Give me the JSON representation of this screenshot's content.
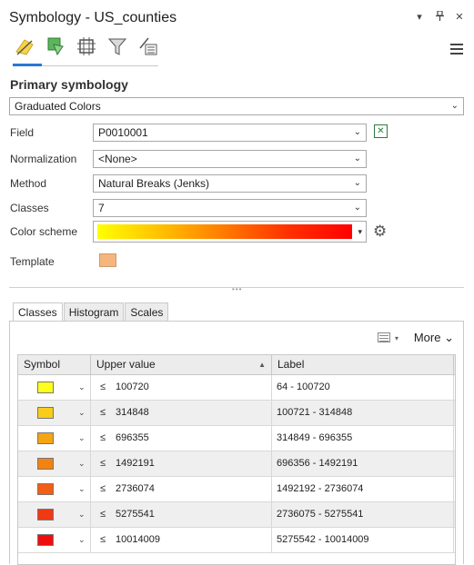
{
  "window": {
    "title": "Symbology - US_counties",
    "controls": [
      "options-chevron-icon",
      "pin-icon",
      "close-icon"
    ]
  },
  "tool_tabs": [
    "primary-symbology-icon",
    "vary-by-attribute-icon",
    "symbol-layers-icon",
    "symbol-masking-icon",
    "more-tools-icon"
  ],
  "primary": {
    "section_title": "Primary symbology",
    "symbology_type": "Graduated Colors"
  },
  "form": {
    "field_label": "Field",
    "field_value": "P0010001",
    "normalization_label": "Normalization",
    "normalization_value": "<None>",
    "method_label": "Method",
    "method_value": "Natural Breaks (Jenks)",
    "classes_label": "Classes",
    "classes_value": "7",
    "color_scheme_label": "Color scheme",
    "template_label": "Template",
    "template_color": "#f4b67e",
    "ramp_colors": [
      "#ffff00",
      "#ffc000",
      "#ff7a00",
      "#ff3000",
      "#ff0000"
    ]
  },
  "tabs": {
    "classes": "Classes",
    "histogram": "Histogram",
    "scales": "Scales",
    "more": "More"
  },
  "table": {
    "headers": {
      "symbol": "Symbol",
      "upper": "Upper value",
      "label": "Label"
    },
    "rows": [
      {
        "color": "#ffff1e",
        "le": "≤",
        "upper": "100720",
        "label": "64 - 100720"
      },
      {
        "color": "#f8cc1a",
        "le": "≤",
        "upper": "314848",
        "label": "100721 - 314848"
      },
      {
        "color": "#f5a412",
        "le": "≤",
        "upper": "696355",
        "label": "314849 - 696355"
      },
      {
        "color": "#f28312",
        "le": "≤",
        "upper": "1492191",
        "label": "696356 - 1492191"
      },
      {
        "color": "#f35e12",
        "le": "≤",
        "upper": "2736074",
        "label": "1492192 - 2736074"
      },
      {
        "color": "#ef3915",
        "le": "≤",
        "upper": "5275541",
        "label": "2736075 - 5275541"
      },
      {
        "color": "#ee0e0e",
        "le": "≤",
        "upper": "10014009",
        "label": "5275542 - 10014009"
      }
    ]
  }
}
